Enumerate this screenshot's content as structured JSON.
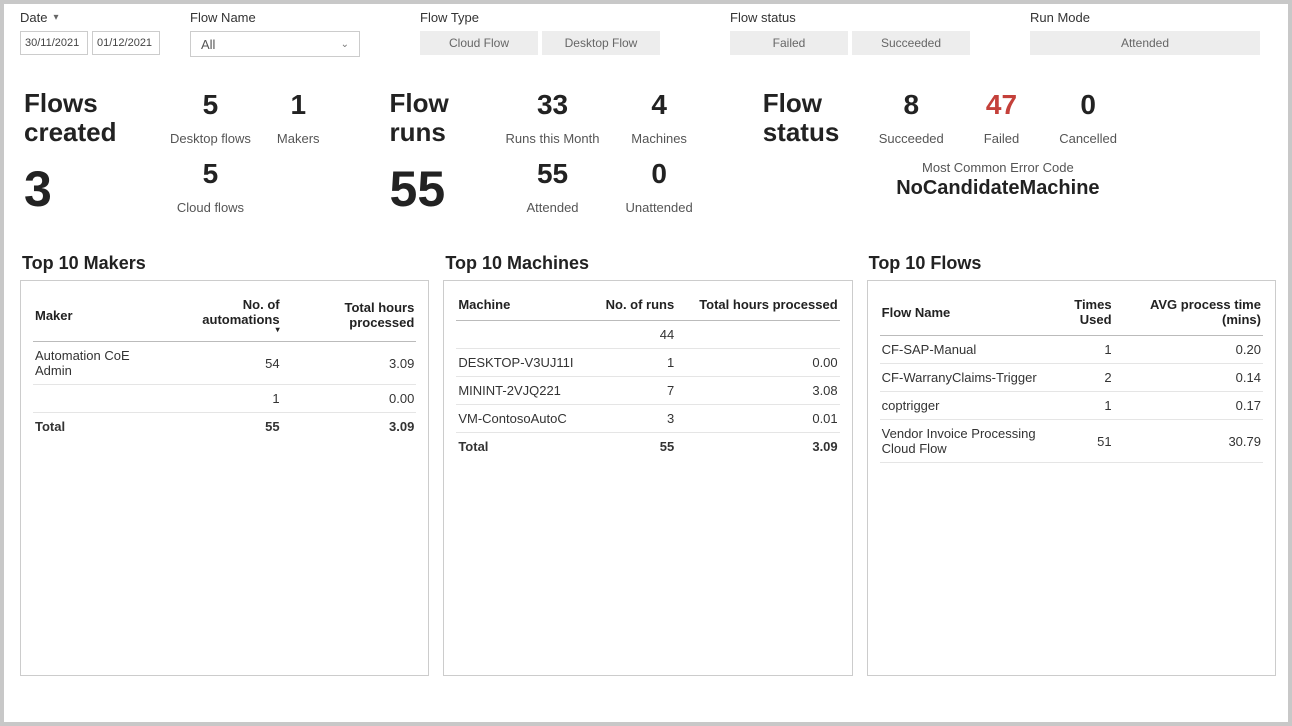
{
  "filters": {
    "date": {
      "label": "Date",
      "start": "30/11/2021",
      "end": "01/12/2021"
    },
    "flowName": {
      "label": "Flow Name",
      "selected": "All"
    },
    "flowType": {
      "label": "Flow Type",
      "options": [
        "Cloud Flow",
        "Desktop Flow"
      ]
    },
    "flowStatus": {
      "label": "Flow status",
      "options": [
        "Failed",
        "Succeeded"
      ]
    },
    "runMode": {
      "label": "Run Mode",
      "options": [
        "Attended"
      ]
    }
  },
  "kpis": {
    "flowsCreated": {
      "title1": "Flows",
      "title2": "created",
      "value": "3",
      "desktop": {
        "value": "5",
        "label": "Desktop flows"
      },
      "cloud": {
        "value": "5",
        "label": "Cloud flows"
      },
      "makers": {
        "value": "1",
        "label": "Makers"
      }
    },
    "flowRuns": {
      "title1": "Flow",
      "title2": "runs",
      "value": "55",
      "month": {
        "value": "33",
        "label": "Runs this Month"
      },
      "attended": {
        "value": "55",
        "label": "Attended"
      },
      "machines": {
        "value": "4",
        "label": "Machines"
      },
      "unattended": {
        "value": "0",
        "label": "Unattended"
      }
    },
    "flowStatus": {
      "title1": "Flow",
      "title2": "status",
      "succeeded": {
        "value": "8",
        "label": "Succeeded"
      },
      "failed": {
        "value": "47",
        "label": "Failed"
      },
      "cancelled": {
        "value": "0",
        "label": "Cancelled"
      },
      "errorLabel": "Most Common Error Code",
      "errorCode": "NoCandidateMachine"
    }
  },
  "tables": {
    "makers": {
      "title": "Top 10 Makers",
      "headers": {
        "maker": "Maker",
        "automations": "No. of automations",
        "hours": "Total hours processed"
      },
      "rows": [
        {
          "maker": "Automation CoE Admin",
          "automations": "54",
          "hours": "3.09"
        },
        {
          "maker": "",
          "automations": "1",
          "hours": "0.00"
        }
      ],
      "total": {
        "label": "Total",
        "automations": "55",
        "hours": "3.09"
      }
    },
    "machines": {
      "title": "Top 10 Machines",
      "headers": {
        "machine": "Machine",
        "runs": "No. of runs",
        "hours": "Total hours processed"
      },
      "rows": [
        {
          "machine": "",
          "runs": "44",
          "hours": ""
        },
        {
          "machine": "DESKTOP-V3UJ11I",
          "runs": "1",
          "hours": "0.00"
        },
        {
          "machine": "MININT-2VJQ221",
          "runs": "7",
          "hours": "3.08"
        },
        {
          "machine": "VM-ContosoAutoC",
          "runs": "3",
          "hours": "0.01"
        }
      ],
      "total": {
        "label": "Total",
        "runs": "55",
        "hours": "3.09"
      }
    },
    "flows": {
      "title": "Top 10 Flows",
      "headers": {
        "flow": "Flow Name",
        "times": "Times Used",
        "avg": "AVG process time (mins)"
      },
      "rows": [
        {
          "flow": "CF-SAP-Manual",
          "times": "1",
          "avg": "0.20"
        },
        {
          "flow": "CF-WarranyClaims-Trigger",
          "times": "2",
          "avg": "0.14"
        },
        {
          "flow": "coptrigger",
          "times": "1",
          "avg": "0.17"
        },
        {
          "flow": "Vendor Invoice Processing Cloud Flow",
          "times": "51",
          "avg": "30.79"
        }
      ]
    }
  }
}
